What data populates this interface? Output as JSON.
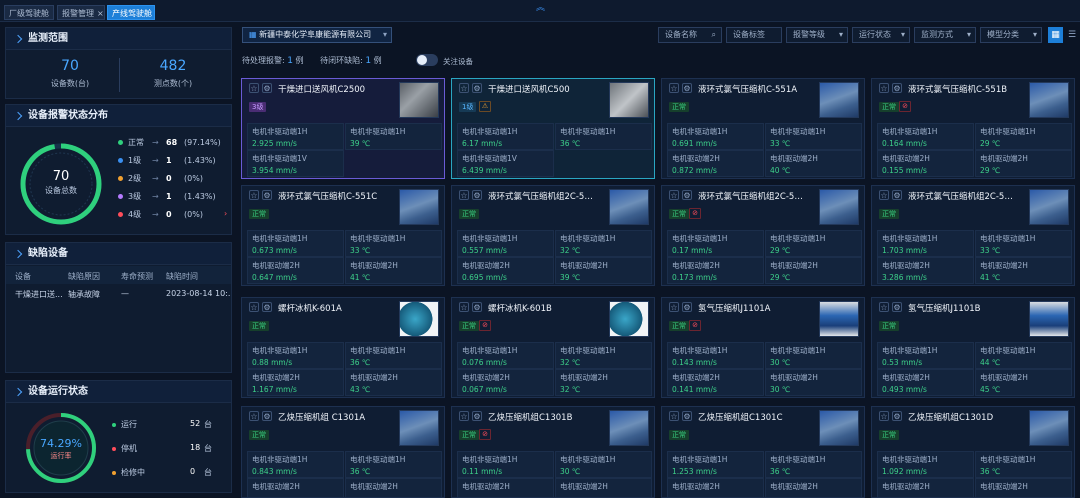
{
  "tabs": [
    {
      "label": "厂级驾驶舱"
    },
    {
      "label": "报警管理"
    },
    {
      "label": "产线驾驶舱"
    }
  ],
  "monitor": {
    "title": "监测范围",
    "devices": "70",
    "devices_label": "设备数(台)",
    "points": "482",
    "points_label": "测点数(个)"
  },
  "alarm_dist": {
    "title": "设备报警状态分布",
    "total": "70",
    "total_label": "设备总数",
    "rows": [
      {
        "label": "正常",
        "arrow": "→",
        "count": "68",
        "pct": "(97.14%)",
        "color": "#2fd07d"
      },
      {
        "label": "1级",
        "arrow": "→",
        "count": "1",
        "pct": "(1.43%)",
        "color": "#3a8ff0"
      },
      {
        "label": "2级",
        "arrow": "→",
        "count": "0",
        "pct": "(0%)",
        "color": "#f0a030"
      },
      {
        "label": "3级",
        "arrow": "→",
        "count": "1",
        "pct": "(1.43%)",
        "color": "#b57bff"
      },
      {
        "label": "4级",
        "arrow": "→",
        "count": "0",
        "pct": "(0%)",
        "color": "#ff4d5a"
      }
    ]
  },
  "defects": {
    "title": "缺陷设备",
    "headers": [
      "设备",
      "缺陷原因",
      "寿命预测",
      "缺陷时间"
    ],
    "rows": [
      [
        "干燥进口送...",
        "轴承故障",
        "—",
        "2023-08-14 10:..."
      ]
    ]
  },
  "run": {
    "title": "设备运行状态",
    "pct": "74.29%",
    "pct_label": "运行率",
    "pct_value": 74.29,
    "rows": [
      {
        "label": "运行",
        "value": "52",
        "unit": "台",
        "color": "#2fd07d"
      },
      {
        "label": "停机",
        "value": "18",
        "unit": "台",
        "color": "#ff4d5a"
      },
      {
        "label": "检修中",
        "value": "0",
        "unit": "台",
        "color": "#f0a030"
      }
    ]
  },
  "filters": {
    "company": "新疆中泰化学阜康能源有限公司",
    "device_name": "设备名称",
    "device_tag": "设备标签",
    "alarm_level": "报警等级",
    "run_status": "运行状态",
    "monitor_mode": "监测方式",
    "model_class": "模型分类",
    "pending_alarm_label": "待处理报警:",
    "pending_alarm_value": "1",
    "pending_unit1": "例",
    "pending_defect_label": "待闭环缺陷:",
    "pending_defect_value": "1",
    "pending_unit2": "例",
    "follow_label": "关注设备"
  },
  "cards": [
    {
      "title": "干燥进口送风机C2500",
      "badge": "3级",
      "badge_type": "l3",
      "extra": "",
      "metrics": [
        [
          "电机非驱动端1H",
          "2.925 mm/s"
        ],
        [
          "电机非驱动端1H",
          "39 ℃"
        ],
        [
          "电机非驱动端1V",
          "3.954 mm/s"
        ]
      ]
    },
    {
      "title": "干燥进口送风机C500",
      "badge": "1级",
      "badge_type": "l1",
      "extra": "warn",
      "metrics": [
        [
          "电机非驱动端1H",
          "6.17 mm/s"
        ],
        [
          "电机非驱动端1H",
          "36 ℃"
        ],
        [
          "电机非驱动端1V",
          "6.439 mm/s"
        ]
      ]
    },
    {
      "title": "液环式氯气压缩机C-551A",
      "badge": "正常",
      "badge_type": "ok",
      "extra": "",
      "metrics": [
        [
          "电机非驱动端1H",
          "0.691 mm/s"
        ],
        [
          "电机非驱动端1H",
          "33 ℃"
        ],
        [
          "电机驱动端2H",
          "0.872 mm/s"
        ],
        [
          "电机驱动端2H",
          "40 ℃"
        ]
      ]
    },
    {
      "title": "液环式氯气压缩机C-551B",
      "badge": "正常",
      "badge_type": "ok",
      "extra": "stop",
      "metrics": [
        [
          "电机非驱动端1H",
          "0.164 mm/s"
        ],
        [
          "电机非驱动端1H",
          "29 ℃"
        ],
        [
          "电机驱动端2H",
          "0.155 mm/s"
        ],
        [
          "电机驱动端2H",
          "29 ℃"
        ]
      ]
    },
    {
      "title": "液环式氯气压缩机C-551C",
      "badge": "正常",
      "badge_type": "ok",
      "extra": "",
      "metrics": [
        [
          "电机非驱动端1H",
          "0.673 mm/s"
        ],
        [
          "电机非驱动端1H",
          "33 ℃"
        ],
        [
          "电机驱动端2H",
          "0.647 mm/s"
        ],
        [
          "电机驱动端2H",
          "41 ℃"
        ]
      ]
    },
    {
      "title": "液环式氯气压缩机组2C-55...",
      "badge": "正常",
      "badge_type": "ok",
      "extra": "",
      "metrics": [
        [
          "电机非驱动端1H",
          "0.557 mm/s"
        ],
        [
          "电机非驱动端1H",
          "32 ℃"
        ],
        [
          "电机驱动端2H",
          "0.695 mm/s"
        ],
        [
          "电机驱动端2H",
          "39 ℃"
        ]
      ]
    },
    {
      "title": "液环式氯气压缩机组2C-55...",
      "badge": "正常",
      "badge_type": "ok",
      "extra": "stop",
      "metrics": [
        [
          "电机非驱动端1H",
          "0.17 mm/s"
        ],
        [
          "电机非驱动端1H",
          "29 ℃"
        ],
        [
          "电机驱动端2H",
          "0.173 mm/s"
        ],
        [
          "电机驱动端2H",
          "29 ℃"
        ]
      ]
    },
    {
      "title": "液环式氯气压缩机组2C-55...",
      "badge": "正常",
      "badge_type": "ok",
      "extra": "",
      "metrics": [
        [
          "电机非驱动端1H",
          "1.703 mm/s"
        ],
        [
          "电机非驱动端1H",
          "33 ℃"
        ],
        [
          "电机驱动端2H",
          "3.286 mm/s"
        ],
        [
          "电机驱动端2H",
          "41 ℃"
        ]
      ]
    },
    {
      "title": "螺杆冰机K-601A",
      "badge": "正常",
      "badge_type": "ok",
      "extra": "",
      "metrics": [
        [
          "电机非驱动端1H",
          "0.88 mm/s"
        ],
        [
          "电机非驱动端1H",
          "36 ℃"
        ],
        [
          "电机驱动端2H",
          "1.167 mm/s"
        ],
        [
          "电机驱动端2H",
          "43 ℃"
        ]
      ]
    },
    {
      "title": "螺杆冰机K-601B",
      "badge": "正常",
      "badge_type": "ok",
      "extra": "stop",
      "metrics": [
        [
          "电机非驱动端1H",
          "0.076 mm/s"
        ],
        [
          "电机非驱动端1H",
          "32 ℃"
        ],
        [
          "电机驱动端2H",
          "0.067 mm/s"
        ],
        [
          "电机驱动端2H",
          "32 ℃"
        ]
      ]
    },
    {
      "title": "氢气压缩机J1101A",
      "badge": "正常",
      "badge_type": "ok",
      "extra": "stop",
      "metrics": [
        [
          "电机非驱动端1H",
          "0.143 mm/s"
        ],
        [
          "电机非驱动端1H",
          "30 ℃"
        ],
        [
          "电机驱动端2H",
          "0.141 mm/s"
        ],
        [
          "电机驱动端2H",
          "30 ℃"
        ]
      ]
    },
    {
      "title": "氢气压缩机J1101B",
      "badge": "正常",
      "badge_type": "ok",
      "extra": "",
      "metrics": [
        [
          "电机非驱动端1H",
          "0.53 mm/s"
        ],
        [
          "电机非驱动端1H",
          "44 ℃"
        ],
        [
          "电机驱动端2H",
          "0.493 mm/s"
        ],
        [
          "电机驱动端2H",
          "45 ℃"
        ]
      ]
    },
    {
      "title": "乙炔压缩机组 C1301A",
      "badge": "正常",
      "badge_type": "ok",
      "extra": "",
      "metrics": [
        [
          "电机非驱动端1H",
          "0.843 mm/s"
        ],
        [
          "电机非驱动端1H",
          "36 ℃"
        ],
        [
          "电机驱动端2H",
          ""
        ],
        [
          "电机驱动端2H",
          ""
        ]
      ]
    },
    {
      "title": "乙炔压缩机组C1301B",
      "badge": "正常",
      "badge_type": "ok",
      "extra": "stop",
      "metrics": [
        [
          "电机非驱动端1H",
          "0.11 mm/s"
        ],
        [
          "电机非驱动端1H",
          "30 ℃"
        ],
        [
          "电机驱动端2H",
          ""
        ],
        [
          "电机驱动端2H",
          ""
        ]
      ]
    },
    {
      "title": "乙炔压缩机组C1301C",
      "badge": "正常",
      "badge_type": "ok",
      "extra": "",
      "metrics": [
        [
          "电机非驱动端1H",
          "1.253 mm/s"
        ],
        [
          "电机非驱动端1H",
          "36 ℃"
        ],
        [
          "电机驱动端2H",
          ""
        ],
        [
          "电机驱动端2H",
          ""
        ]
      ]
    },
    {
      "title": "乙炔压缩机组C1301D",
      "badge": "正常",
      "badge_type": "ok",
      "extra": "",
      "metrics": [
        [
          "电机非驱动端1H",
          "1.092 mm/s"
        ],
        [
          "电机非驱动端1H",
          "36 ℃"
        ],
        [
          "电机驱动端2H",
          ""
        ],
        [
          "电机驱动端2H",
          ""
        ]
      ]
    }
  ]
}
